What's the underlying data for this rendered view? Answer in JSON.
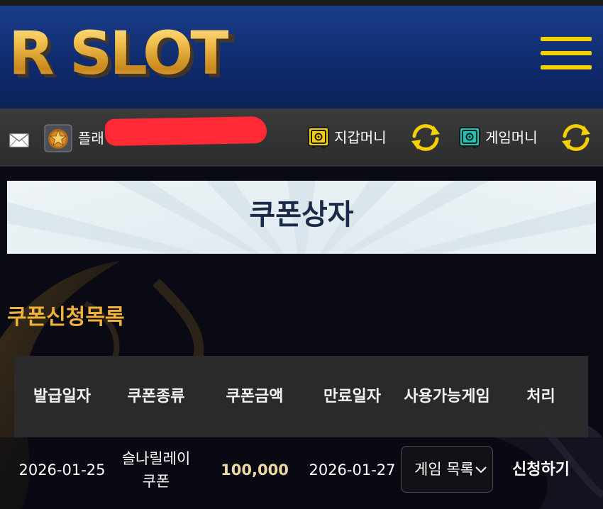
{
  "header": {
    "logo_text": "R SLOT",
    "menu_icon": "hamburger-icon",
    "accent": "#f5d000"
  },
  "userbar": {
    "mail_icon": "mail-icon",
    "level_icon": "level-badge-icon",
    "username": "플래",
    "wallet_label": "지갑머니",
    "wallet_icon": "safe-icon",
    "game_label": "게임머니",
    "game_icon": "safe-icon",
    "refresh_icon": "refresh-icon"
  },
  "page": {
    "title": "쿠폰상자",
    "section_title": "쿠폰신청목록"
  },
  "table": {
    "columns": [
      "발급일자",
      "쿠폰종류",
      "쿠폰금액",
      "만료일자",
      "사용가능게임",
      "처리"
    ],
    "rows": [
      {
        "issue_date": "2026-01-25",
        "coupon_type": "슬나릴레이 쿠폰",
        "amount": "100,000",
        "expiry_date": "2026-01-27",
        "game_select": "게임 목록",
        "action": "신청하기"
      }
    ]
  },
  "colors": {
    "header_bg": "#0f2a6b",
    "section_title": "#f0b23a",
    "amount": "#efd9a6"
  }
}
